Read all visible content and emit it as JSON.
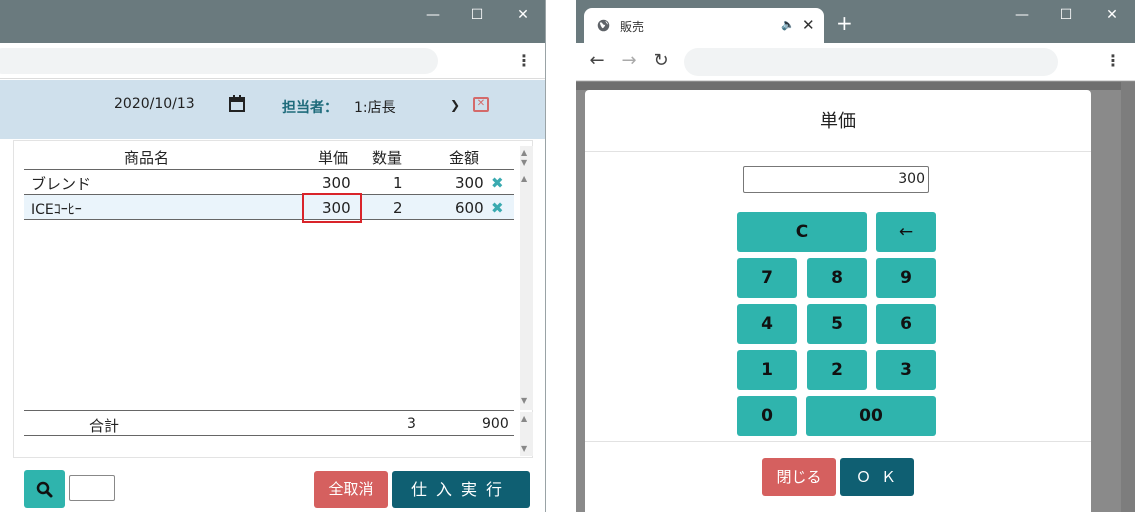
{
  "left": {
    "window_controls": {
      "minimize": "—",
      "maximize": "☐",
      "close": "✕"
    },
    "header": {
      "date": "2020/10/13",
      "staff_label": "担当者：",
      "staff_value": "1:店長"
    },
    "table": {
      "columns": [
        "商品名",
        "単価",
        "数量",
        "金額"
      ],
      "rows": [
        {
          "name": "ブレンド",
          "price": "300",
          "qty": "1",
          "amount": "300"
        },
        {
          "name": "ICEｺｰﾋｰ",
          "price": "300",
          "qty": "2",
          "amount": "600"
        }
      ],
      "total_label": "合計",
      "total_qty": "3",
      "total_amount": "900"
    },
    "buttons": {
      "cancel_all": "全取消",
      "run": "仕入実行"
    }
  },
  "right": {
    "tab": {
      "title": "販売"
    },
    "window_controls": {
      "minimize": "—",
      "maximize": "☐",
      "close": "✕"
    },
    "modal": {
      "title": "単価",
      "input_value": "300",
      "keys": {
        "clear": "C",
        "back": "←",
        "k7": "7",
        "k8": "8",
        "k9": "9",
        "k4": "4",
        "k5": "5",
        "k6": "6",
        "k1": "1",
        "k2": "2",
        "k3": "3",
        "k0": "0",
        "k00": "00"
      },
      "close_label": "閉じる",
      "ok_label": "ＯＫ"
    }
  },
  "colors": {
    "accent_teal": "#2fb4ad",
    "primary_dark": "#0f5f72",
    "danger": "#d5605f",
    "header_bg": "#cfe0ec",
    "titlebar": "#6a7a7e",
    "highlight_red": "#d9242a"
  }
}
